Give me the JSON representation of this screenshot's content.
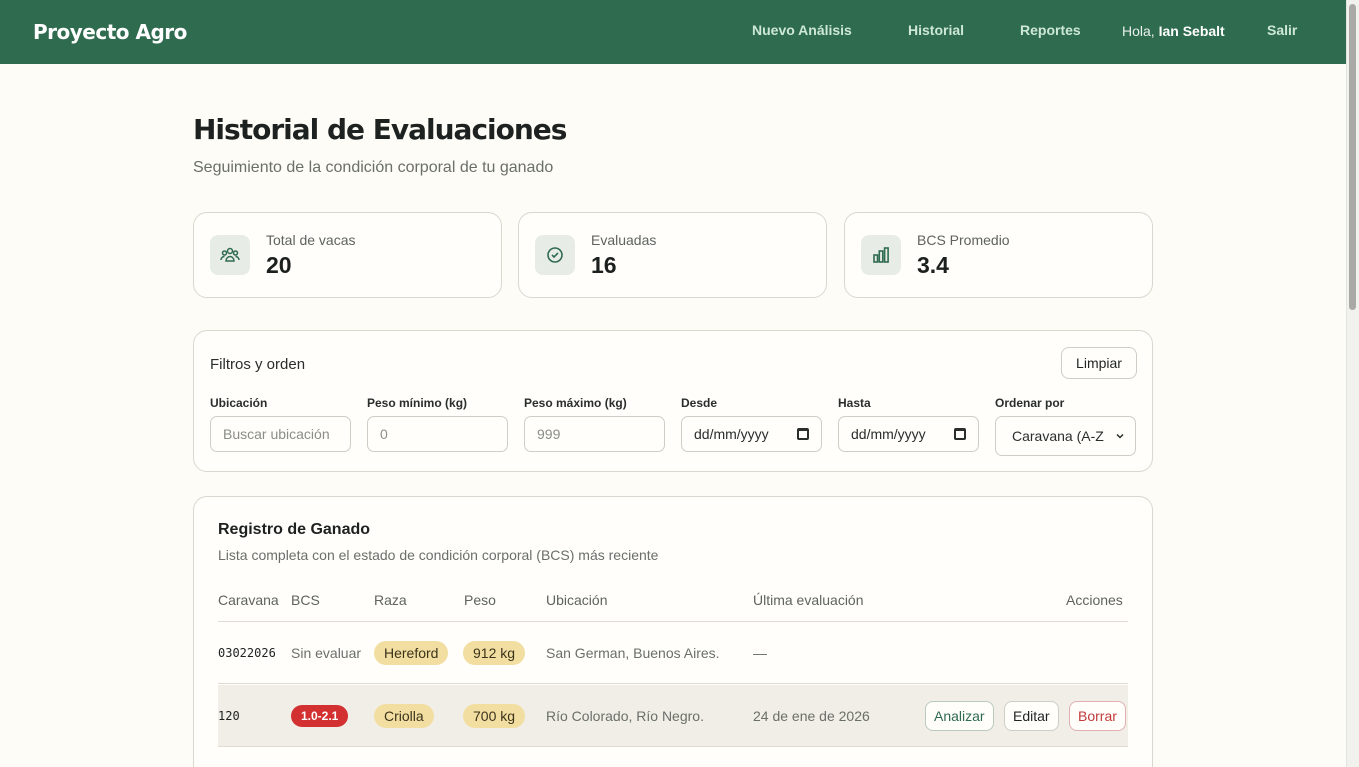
{
  "navbar": {
    "brand": "Proyecto Agro",
    "links": [
      "Nuevo Análisis",
      "Historial",
      "Reportes"
    ],
    "greeting_prefix": "Hola,",
    "user_name": "Ian Sebalt",
    "logout": "Salir"
  },
  "page": {
    "title": "Historial de Evaluaciones",
    "subtitle": "Seguimiento de la condición corporal de tu ganado"
  },
  "stats": [
    {
      "label": "Total de vacas",
      "value": "20",
      "icon": "users-icon"
    },
    {
      "label": "Evaluadas",
      "value": "16",
      "icon": "check-circle-icon"
    },
    {
      "label": "BCS Promedio",
      "value": "3.4",
      "icon": "bar-chart-icon"
    }
  ],
  "filters": {
    "title": "Filtros y orden",
    "clear_label": "Limpiar",
    "location_label": "Ubicación",
    "location_placeholder": "Buscar ubicación",
    "min_weight_label": "Peso mínimo (kg)",
    "min_weight_placeholder": "0",
    "max_weight_label": "Peso máximo (kg)",
    "max_weight_placeholder": "999",
    "from_label": "Desde",
    "from_value": "dd/mm/yyyy",
    "to_label": "Hasta",
    "to_value": "dd/mm/yyyy",
    "sort_label": "Ordenar por",
    "sort_value": "Caravana (A-Z"
  },
  "registry": {
    "title": "Registro de Ganado",
    "subtitle": "Lista completa con el estado de condición corporal (BCS) más reciente",
    "columns": [
      "Caravana",
      "BCS",
      "Raza",
      "Peso",
      "Ubicación",
      "Última evaluación",
      "Acciones"
    ],
    "rows": [
      {
        "tag": "03022026",
        "bcs": "Sin evaluar",
        "breed": "Hereford",
        "weight": "912 kg",
        "location": "San German, Buenos Aires.",
        "last_eval": "—"
      },
      {
        "tag": "120",
        "bcs": "1.0-2.1",
        "breed": "Criolla",
        "weight": "700 kg",
        "location": "Río Colorado, Río Negro.",
        "last_eval": "24 de ene de 2026",
        "actions": {
          "analyze": "Analizar",
          "edit": "Editar",
          "delete": "Borrar"
        }
      }
    ]
  },
  "colors": {
    "nav_bg": "#2f6b4f",
    "page_bg": "#fdfcf6",
    "tag_bg": "#f2dea0",
    "bcs_low": "#d33131"
  }
}
